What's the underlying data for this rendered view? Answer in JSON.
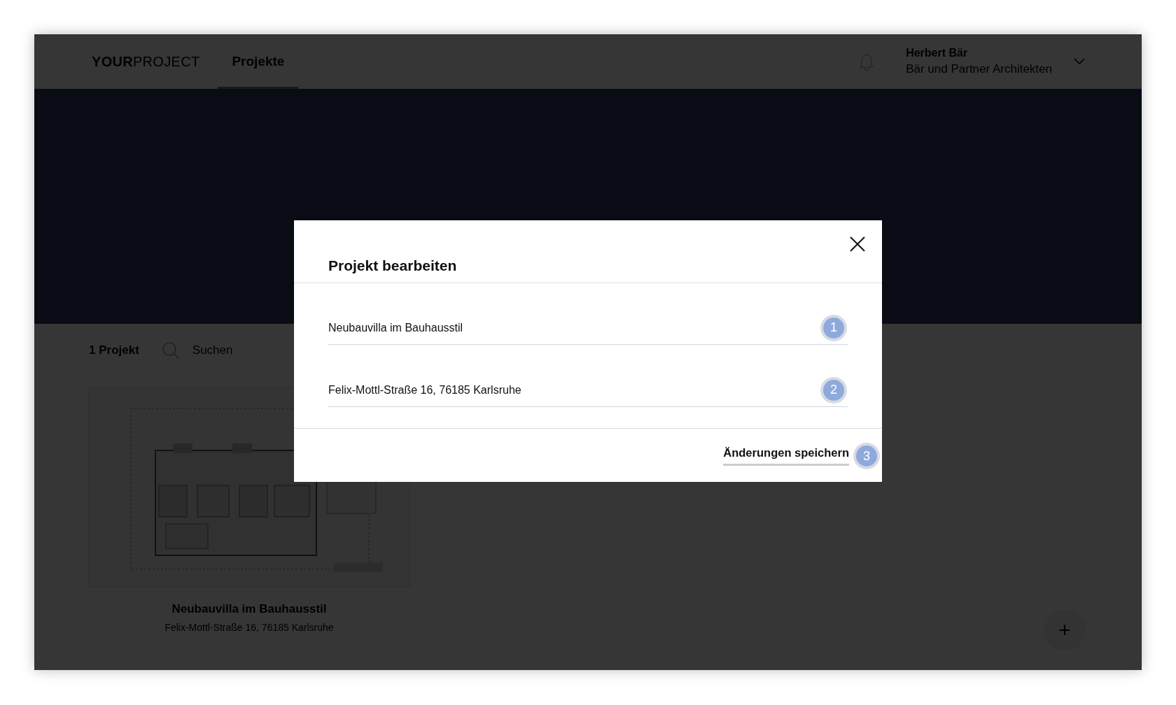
{
  "header": {
    "logo": {
      "bold": "YOUR",
      "light": "PROJECT"
    },
    "tabs": [
      {
        "label": "Projekte",
        "selected": true
      }
    ],
    "user": {
      "name": "Herbert Bär",
      "company": "Bär und Partner Architekten"
    }
  },
  "toolbar": {
    "count": "1 Projekt",
    "search": {
      "placeholder": "Suchen"
    }
  },
  "projects": [
    {
      "title": "Neubauvilla im Bauhausstil",
      "address": "Felix-Mottl-Straße 16, 76185 Karlsruhe"
    }
  ],
  "fab": {
    "label": "+"
  },
  "modal": {
    "title": "Projekt bearbeiten",
    "fields": [
      {
        "value": "Neubauvilla im Bauhausstil",
        "badge": "1"
      },
      {
        "value": "Felix-Mottl-Straße 16, 76185 Karlsruhe",
        "badge": "2"
      }
    ],
    "save": {
      "label": "Änderungen speichern",
      "badge": "3"
    }
  }
}
